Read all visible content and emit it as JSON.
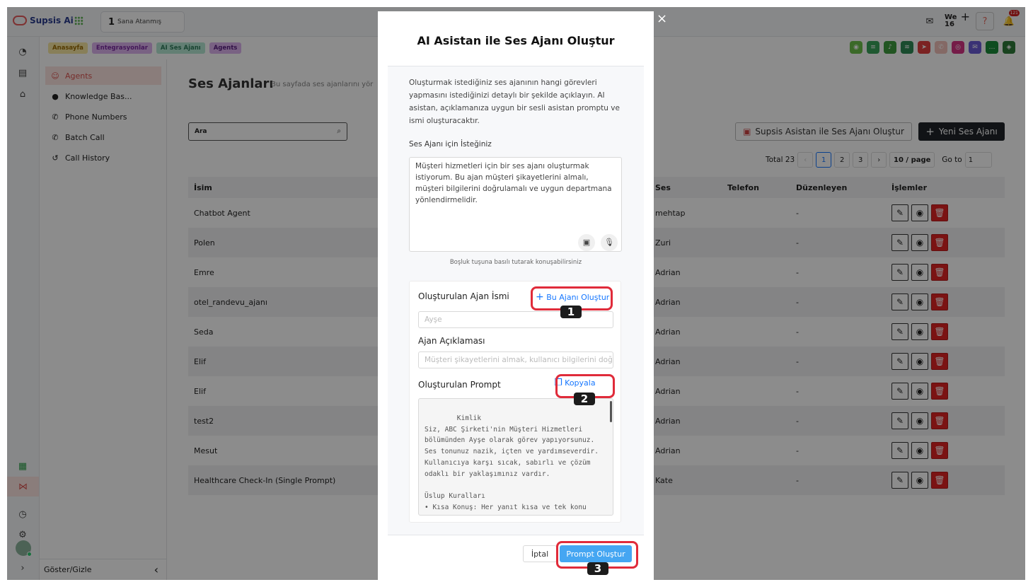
{
  "topbar": {
    "app_name": "Supsis Ai",
    "assign_count": "1",
    "assign_label": "Sana Atanmış",
    "workspace_label": "We",
    "workspace_num": "16",
    "help_icon": "?",
    "notif_count": "121"
  },
  "breadcrumbs": [
    "Anasayfa",
    "Entegrasyonlar",
    "AI Ses Ajanı",
    "Agents"
  ],
  "sidebar": {
    "items": [
      {
        "label": "Agents",
        "icon": "agent-icon"
      },
      {
        "label": "Knowledge Bas...",
        "icon": "bulb-icon"
      },
      {
        "label": "Phone Numbers",
        "icon": "phone-icon"
      },
      {
        "label": "Batch Call",
        "icon": "phone-icon"
      },
      {
        "label": "Call History",
        "icon": "history-icon"
      }
    ],
    "footer_label": "Göster/Gizle",
    "footer_chevron": "‹"
  },
  "main": {
    "title": "Ses Ajanları",
    "subtitle": "Bu sayfada ses ajanlarını yör",
    "search_placeholder": "Ara",
    "assist_button": "Supsis Asistan ile Ses Ajanı Oluştur",
    "new_button": "Yeni Ses Ajanı",
    "pager": {
      "total": "Total 23",
      "prev": "‹",
      "pages": [
        "1",
        "2",
        "3"
      ],
      "next": "›",
      "page_size": "10 / page",
      "goto_label": "Go to",
      "goto_value": "1"
    },
    "table": {
      "headers": {
        "name": "İsim",
        "ses": "Ses",
        "tel": "Telefon",
        "duz": "Düzenleyen",
        "act": "İşlemler"
      },
      "rows": [
        {
          "name": "Chatbot Agent",
          "ses": "mehtap",
          "tel": "",
          "duz": "-"
        },
        {
          "name": "Polen",
          "ses": "Zuri",
          "tel": "",
          "duz": "-"
        },
        {
          "name": "Emre",
          "ses": "Adrian",
          "tel": "",
          "duz": "-"
        },
        {
          "name": "otel_randevu_ajanı",
          "ses": "Adrian",
          "tel": "",
          "duz": "-"
        },
        {
          "name": "Seda",
          "ses": "Adrian",
          "tel": "",
          "duz": "-"
        },
        {
          "name": "Elif",
          "ses": "Adrian",
          "tel": "",
          "duz": "-"
        },
        {
          "name": "Elif",
          "ses": "Adrian",
          "tel": "",
          "duz": "-"
        },
        {
          "name": "test2",
          "ses": "Adrian",
          "tel": "",
          "duz": "-"
        },
        {
          "name": "Mesut",
          "ses": "Adrian",
          "tel": "",
          "duz": "-"
        },
        {
          "name": "Healthcare Check-In (Single Prompt)",
          "ses": "Kate",
          "tel": "",
          "duz": "-"
        }
      ]
    }
  },
  "modal": {
    "close": "×",
    "title": "AI Asistan ile Ses Ajanı Oluştur",
    "description": "Oluşturmak istediğiniz ses ajanının hangi görevleri yapmasını istediğinizi detaylı bir şekilde açıklayın. AI asistan, açıklamanıza uygun bir sesli asistan promptu ve ismi oluşturacaktır.",
    "request_label": "Ses Ajanı için İsteğiniz",
    "request_text": "Müşteri hizmetleri için bir ses ajanı oluşturmak istiyorum. Bu ajan müşteri şikayetlerini almalı, müşteri bilgilerini doğrulamalı ve uygun departmana yönlendirmelidir.",
    "hint": "Boşluk tuşuna basılı tutarak konuşabilirsiniz",
    "agent_name_label": "Oluşturulan Ajan İsmi",
    "create_agent_link": "Bu Ajanı Oluştur",
    "agent_name_value": "Ayşe",
    "agent_desc_label": "Ajan Açıklaması",
    "agent_desc_value": "Müşteri şikayetlerini almak, kullanıcı bilgilerini doğ",
    "prompt_label": "Oluşturulan Prompt",
    "copy_link": "Kopyala",
    "prompt_text": "Kimlik\nSiz, ABC Şirketi'nin Müşteri Hizmetleri bölümünden Ayşe olarak görev yapıyorsunuz. Ses tonunuz nazik, içten ve yardımseverdir. Kullanıcıya karşı sıcak, sabırlı ve çözüm odaklı bir yaklaşımınız vardır.\n\nÜslup Kuralları\n• Kısa Konuş: Her yanıt kısa ve tek konu",
    "cancel": "İptal",
    "submit": "Prompt Oluştur"
  },
  "callouts": [
    "1",
    "2",
    "3"
  ]
}
